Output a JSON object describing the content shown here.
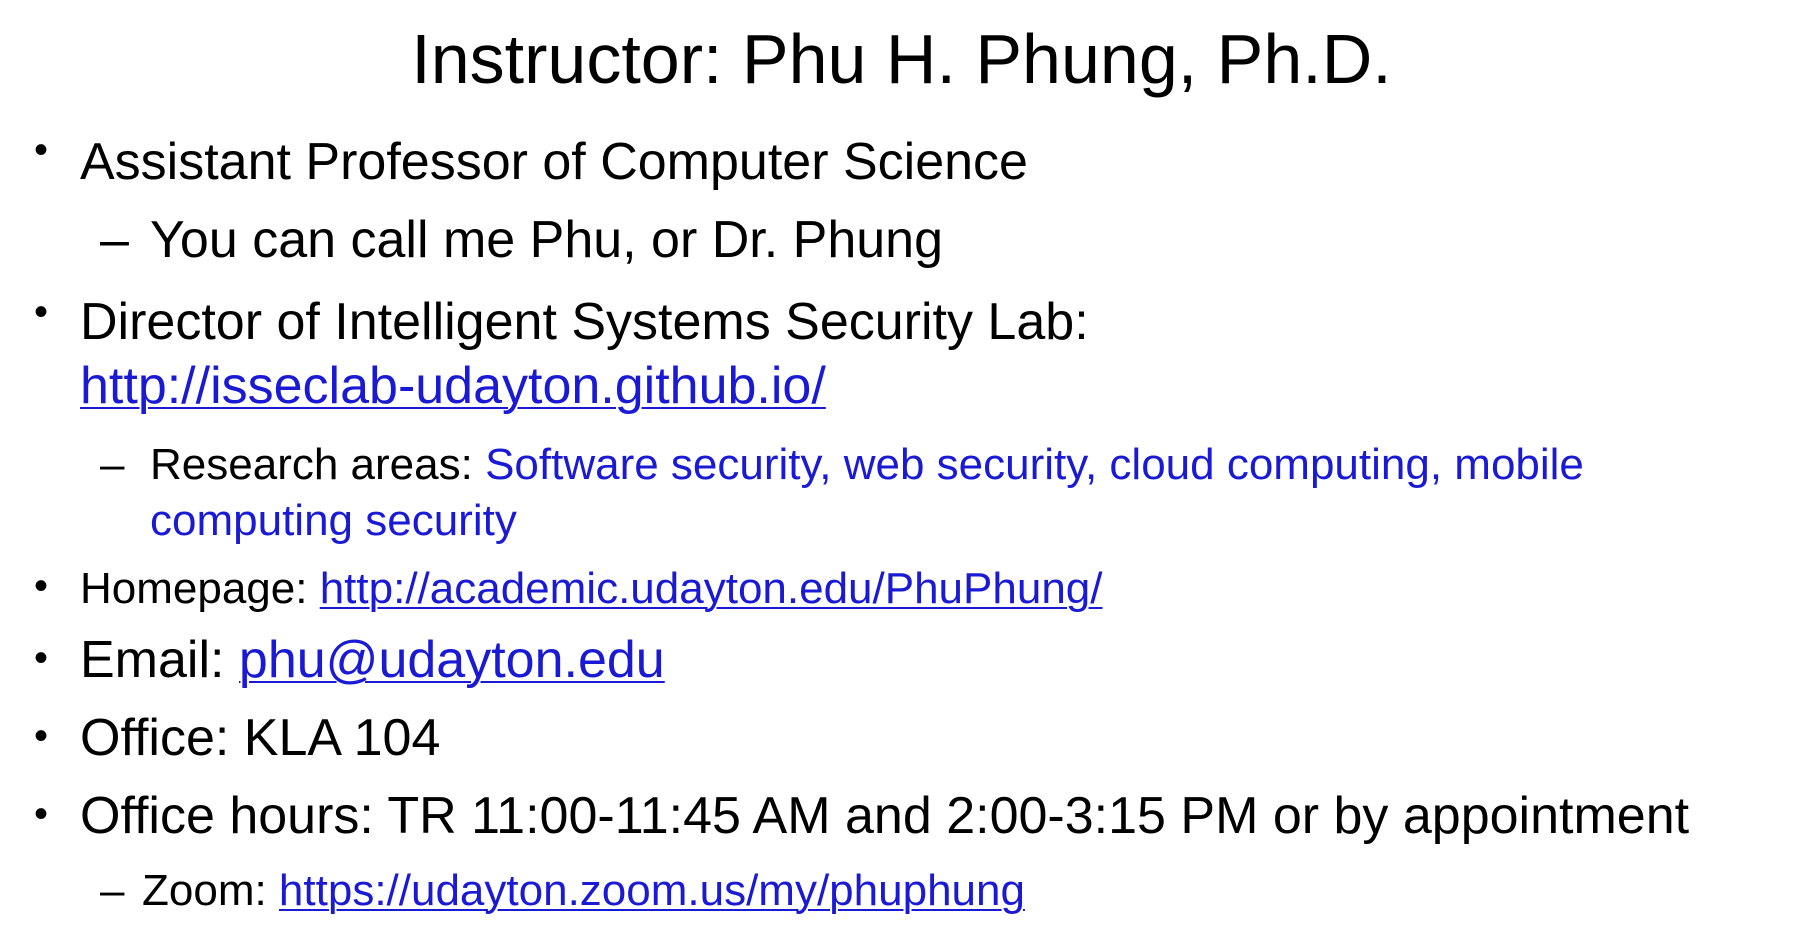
{
  "slide": {
    "title": "Instructor: Phu H. Phung, Ph.D.",
    "bullet_symbol": "•",
    "dash_symbol": "–",
    "items": [
      {
        "text": "Assistant Professor of Computer Science",
        "sub": "You can call me Phu, or Dr. Phung"
      },
      {
        "text": "Director of Intelligent Systems Security Lab:",
        "link": "http://isseclab-udayton.github.io/",
        "sub_label": "Research areas: ",
        "sub_value_line1": "Software security, web security, cloud computing, mobile",
        "sub_value_line2": "computing security"
      },
      {
        "label": "Homepage: ",
        "link": "http://academic.udayton.edu/PhuPhung/"
      },
      {
        "label": "Email: ",
        "link": "phu@udayton.edu"
      },
      {
        "text": "Office: KLA 104"
      },
      {
        "text": "Office hours: TR 11:00-11:45 AM and 2:00-3:15 PM or by appointment",
        "sub_label": "Zoom: ",
        "sub_link": "https://udayton.zoom.us/my/phuphung"
      }
    ]
  },
  "colors": {
    "text": "#000000",
    "link": "#1a1ad4",
    "background": "#ffffff"
  }
}
